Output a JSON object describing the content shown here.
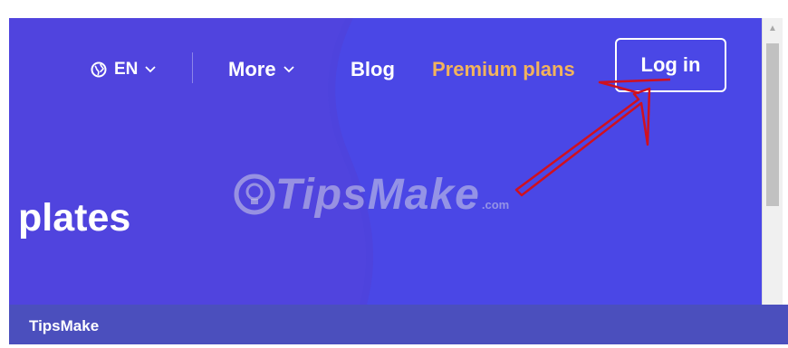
{
  "nav": {
    "language": "EN",
    "more": "More",
    "blog": "Blog",
    "premium": "Premium plans",
    "login": "Log in"
  },
  "hero": {
    "headline_fragment": "plates"
  },
  "watermark": {
    "brand": "TipsMake",
    "domain": ".com"
  },
  "caption": "TipsMake",
  "colors": {
    "background": "#4a47e6",
    "premium_accent": "#f2b35c",
    "annotation_arrow": "#d0101f",
    "caption_bar": "#4b4fbd"
  },
  "icons": {
    "language": "globe-icon",
    "dropdown": "chevron-down-icon",
    "scroll_up": "scroll-up-arrow-icon"
  }
}
